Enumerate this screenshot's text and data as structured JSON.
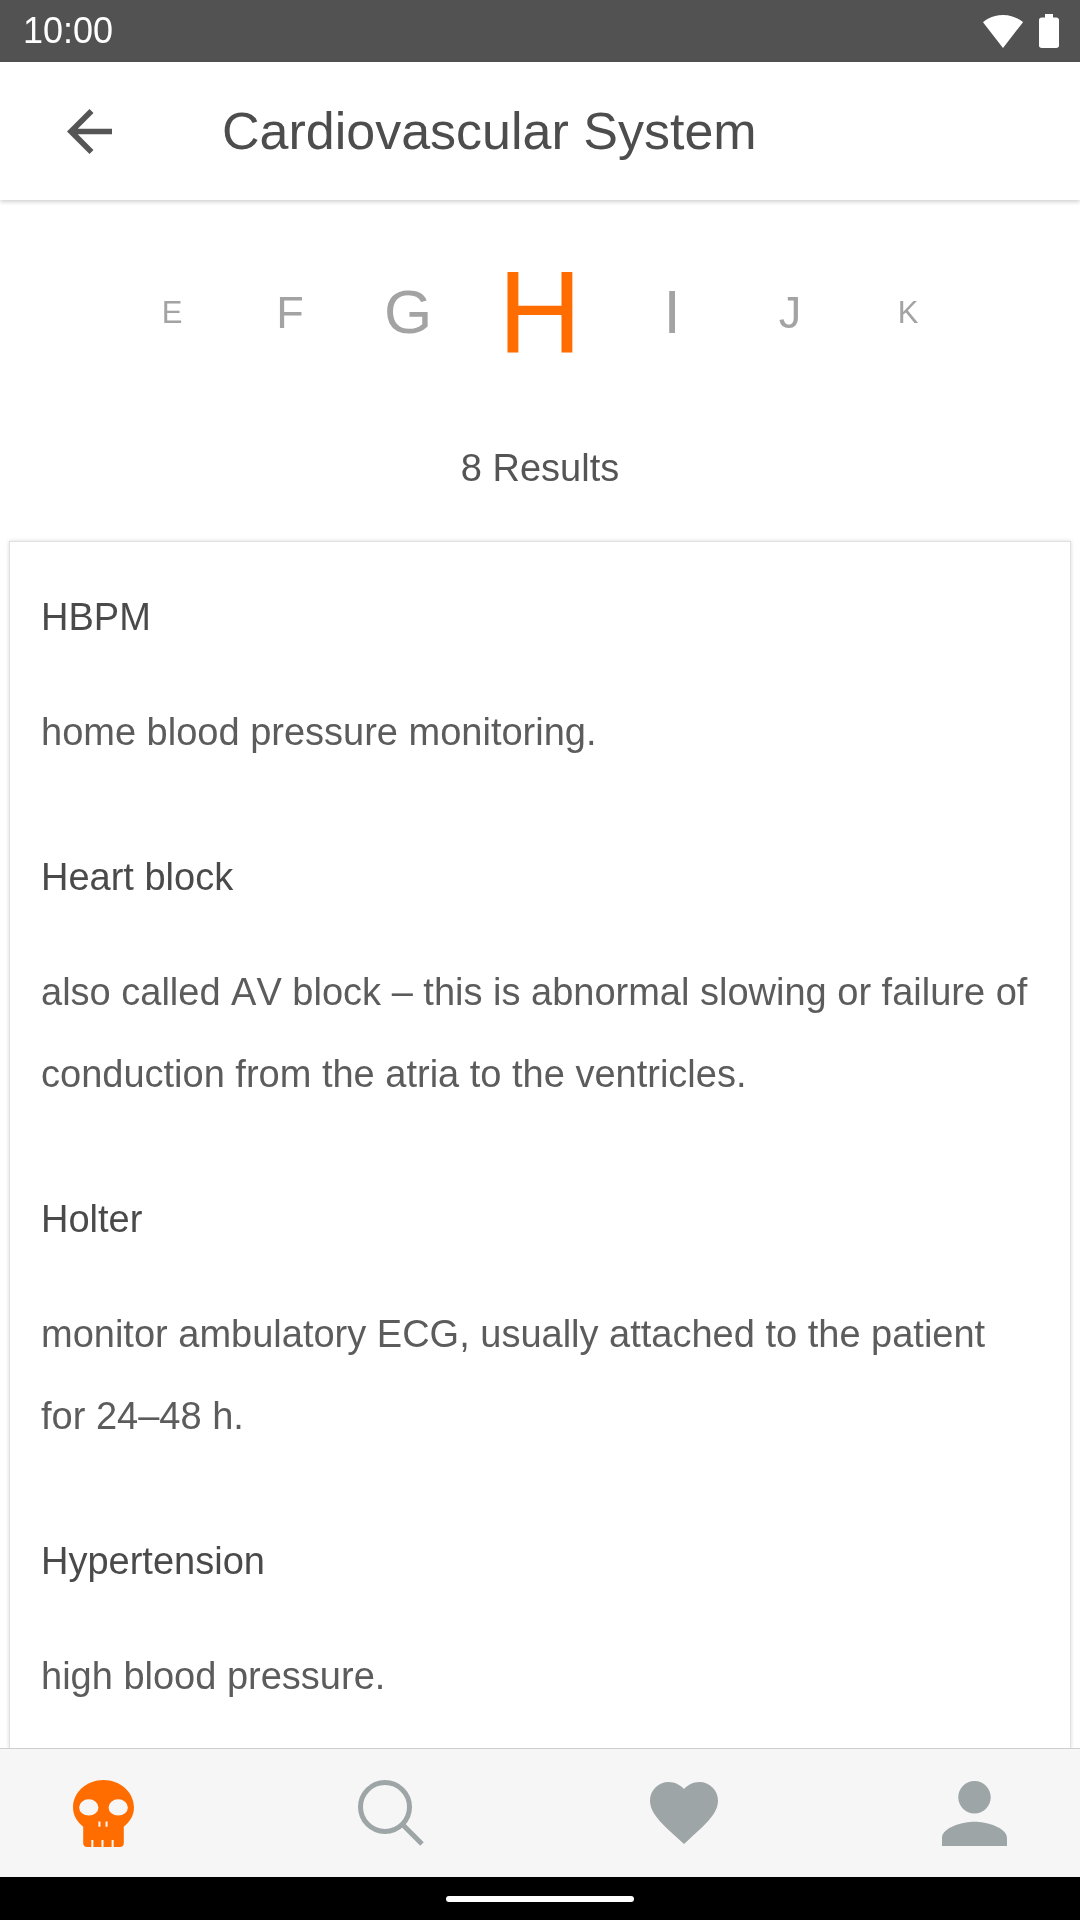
{
  "status_bar": {
    "time": "10:00"
  },
  "app_bar": {
    "title": "Cardiovascular System"
  },
  "letter_picker": [
    {
      "label": "E",
      "selected": false
    },
    {
      "label": "F",
      "selected": false
    },
    {
      "label": "G",
      "selected": false
    },
    {
      "label": "H",
      "selected": true
    },
    {
      "label": "I",
      "selected": false
    },
    {
      "label": "J",
      "selected": false
    },
    {
      "label": "K",
      "selected": false
    }
  ],
  "results_count": "8 Results",
  "entries": [
    {
      "term": "HBPM",
      "definition": "home blood pressure monitoring."
    },
    {
      "term": "Heart block",
      "definition": "also called AV block – this is abnormal slowing or failure of conduction from the atria to the ventricles."
    },
    {
      "term": "Holter",
      "definition": "monitor ambulatory ECG, usually attached to the patient for 24–48 h."
    },
    {
      "term": "Hypertension",
      "definition": "high blood pressure."
    }
  ],
  "bottom_nav": [
    {
      "kind": "skull",
      "selected": true
    },
    {
      "kind": "search",
      "selected": false
    },
    {
      "kind": "heart",
      "selected": false
    },
    {
      "kind": "profile",
      "selected": false
    }
  ]
}
